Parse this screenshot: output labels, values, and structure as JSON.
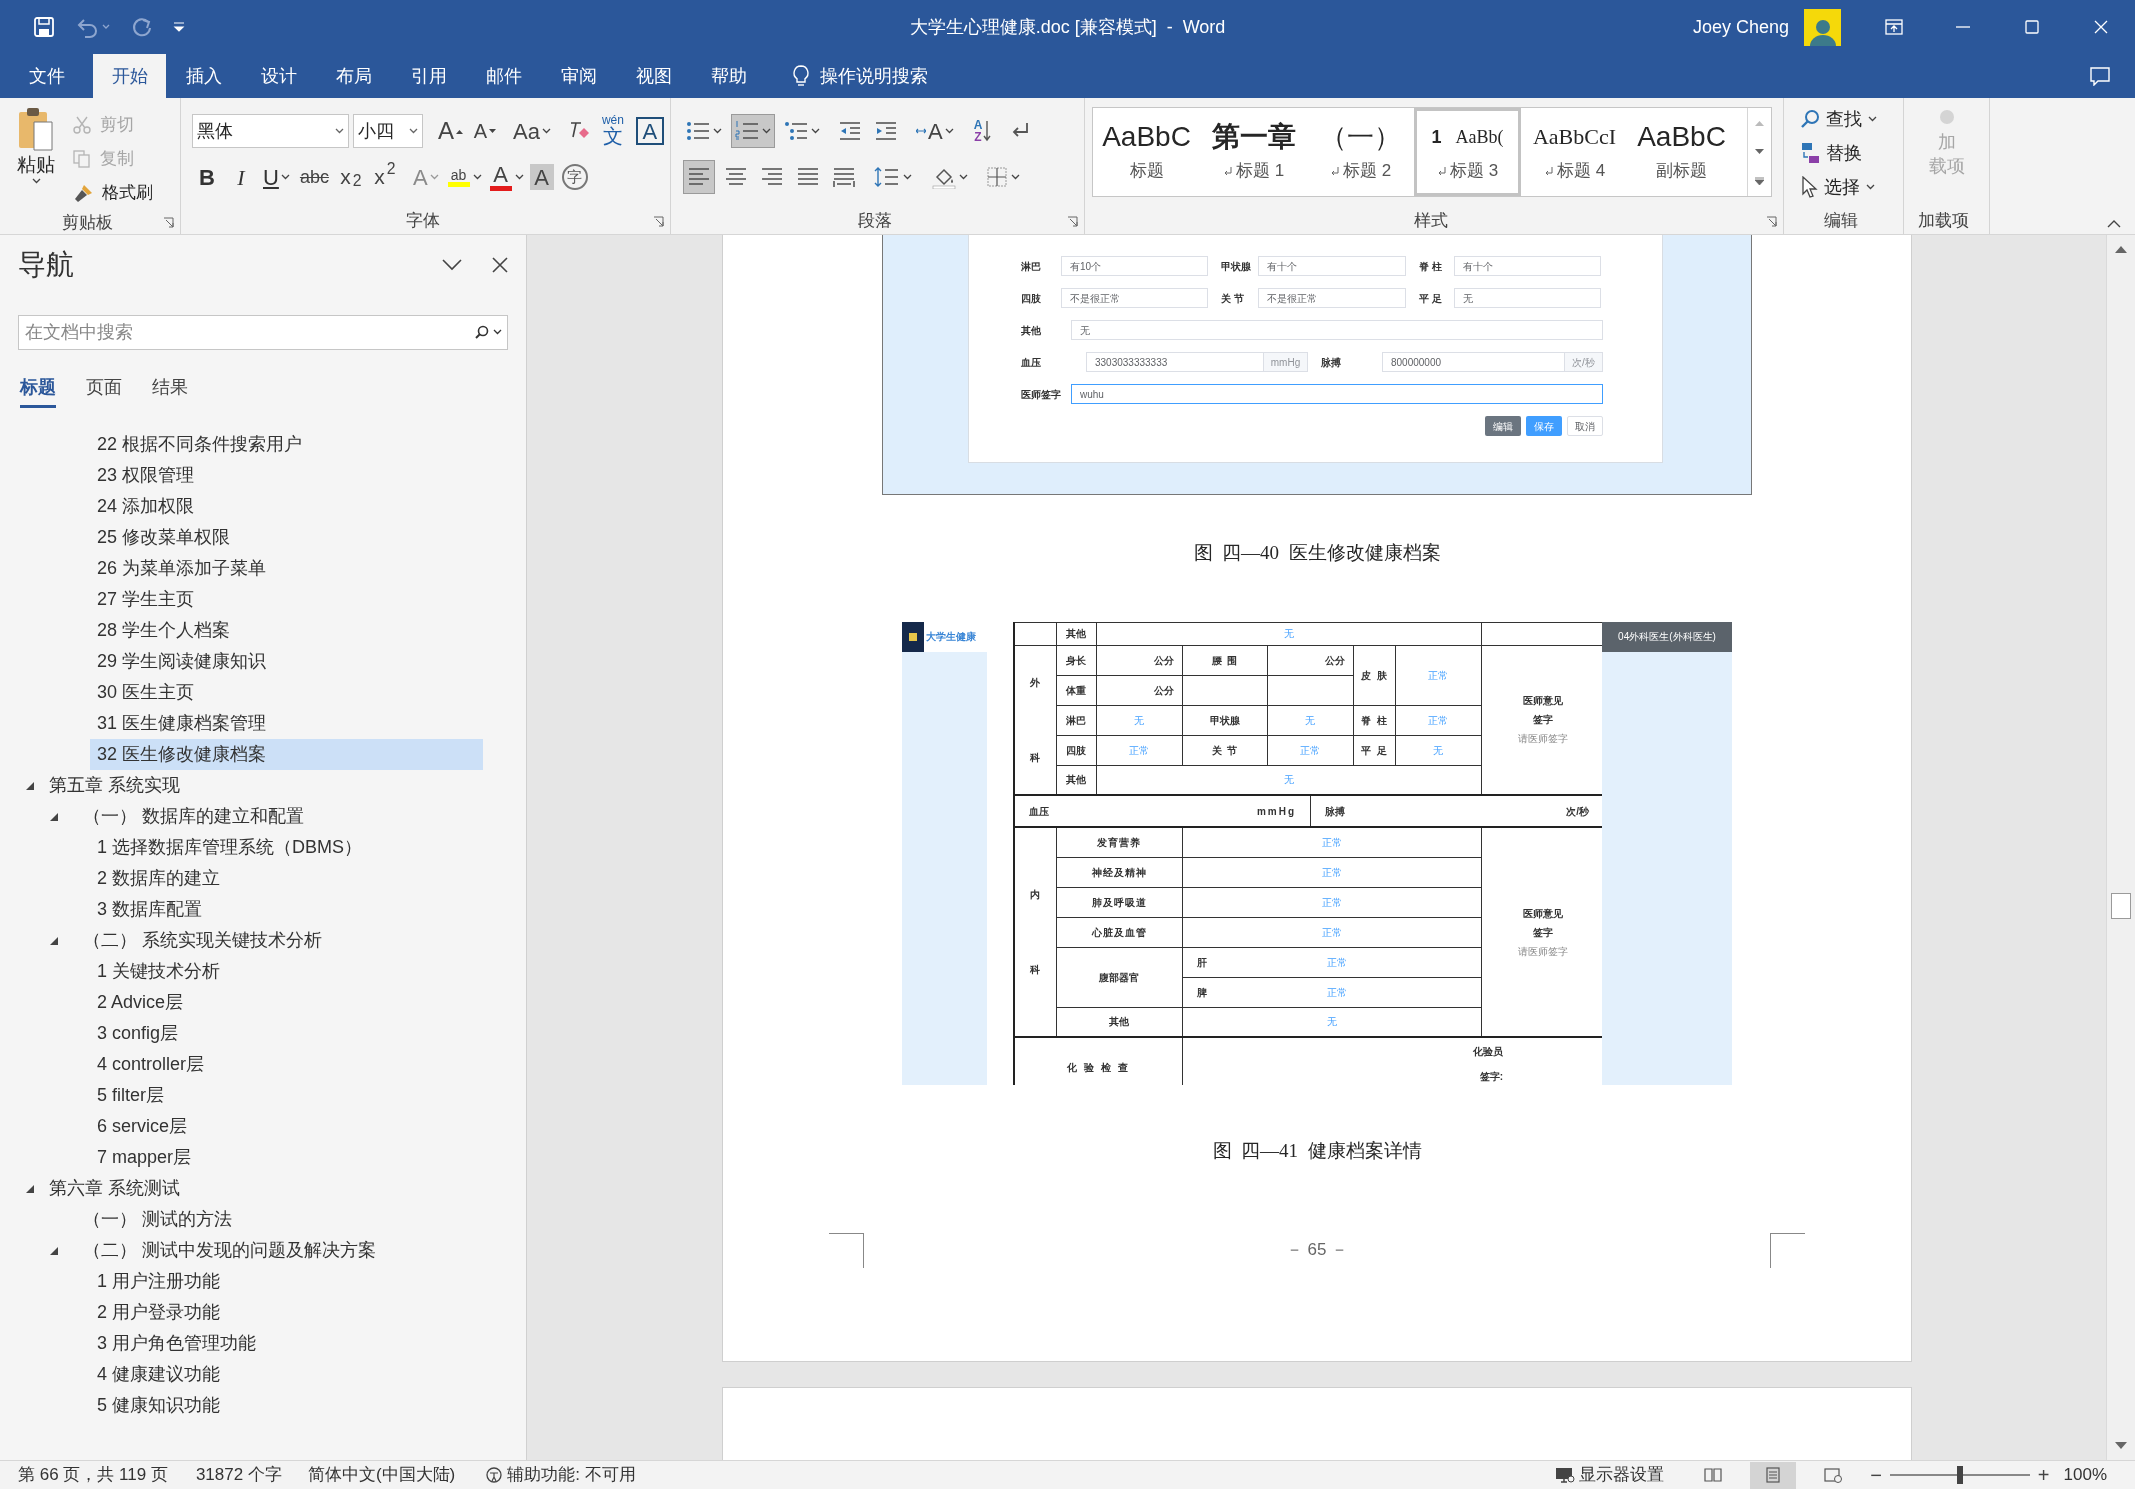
{
  "window": {
    "title": "大学生心理健康.doc [兼容模式]  -  Word",
    "user": "Joey Cheng"
  },
  "ribbon_tabs": [
    {
      "label": "文件",
      "selected": false
    },
    {
      "label": "开始",
      "selected": true
    },
    {
      "label": "插入",
      "selected": false
    },
    {
      "label": "设计",
      "selected": false
    },
    {
      "label": "布局",
      "selected": false
    },
    {
      "label": "引用",
      "selected": false
    },
    {
      "label": "邮件",
      "selected": false
    },
    {
      "label": "审阅",
      "selected": false
    },
    {
      "label": "视图",
      "selected": false
    },
    {
      "label": "帮助",
      "selected": false
    }
  ],
  "tell_me": "操作说明搜索",
  "ribbon": {
    "clipboard": {
      "paste": "粘贴",
      "cut": {
        "label": "剪切",
        "disabled": true
      },
      "copy": {
        "label": "复制",
        "disabled": true
      },
      "format_painter": {
        "label": "格式刷",
        "disabled": false
      },
      "group": "剪贴板"
    },
    "font": {
      "name": "黑体",
      "size": "小四",
      "grow": "A",
      "shrink": "A",
      "change_case": "Aa",
      "phonetic_top": "wén",
      "phonetic_char": "文",
      "char_border": "A",
      "bold": "B",
      "italic": "I",
      "underline": "U",
      "strike": "abc",
      "subscript": "x$_{2}$",
      "superscript": "x$^{2}$",
      "text_effects": "A",
      "highlight": "ab",
      "font_color": "A",
      "char_shading": "A",
      "enclose": "字",
      "group": "字体"
    },
    "paragraph": {
      "numbering_selected": true,
      "asian_layout": "A",
      "sort_top": "A",
      "sort_bottom": "Z",
      "align": [
        {
          "kind": "left",
          "selected": true
        },
        {
          "kind": "center",
          "selected": false
        },
        {
          "kind": "right",
          "selected": false
        },
        {
          "kind": "justify",
          "selected": false
        },
        {
          "kind": "distributed",
          "selected": false
        }
      ],
      "group": "段落"
    },
    "styles": {
      "items": [
        {
          "kind": "title",
          "preview": "AaBbC",
          "name": "标题",
          "para_mark": false,
          "selected": false
        },
        {
          "kind": "h1",
          "preview": "第一章",
          "name": "标题 1",
          "para_mark": true,
          "selected": false
        },
        {
          "kind": "h2",
          "preview": "（一）",
          "name": "标题 2",
          "para_mark": true,
          "selected": false
        },
        {
          "kind": "h3",
          "preview": "1",
          "preview_2": "AaBb(",
          "name": "标题 3",
          "para_mark": true,
          "selected": true
        },
        {
          "kind": "h4",
          "preview": "AaBbCcI",
          "name": "标题 4",
          "para_mark": true,
          "selected": false
        },
        {
          "kind": "subtitle",
          "preview": "AaBbC",
          "name": "副标题",
          "para_mark": false,
          "selected": false
        }
      ],
      "group": "样式"
    },
    "editing": {
      "find": "查找",
      "replace": "替换",
      "select": "选择",
      "group": "编辑"
    },
    "addins": {
      "button_lines": [
        "加",
        "载项"
      ],
      "disabled": true,
      "group": "加载项"
    }
  },
  "navigation": {
    "title": "导航",
    "search_placeholder": "在文档中搜索",
    "tabs": [
      {
        "label": "标题",
        "selected": true
      },
      {
        "label": "页面",
        "selected": false
      },
      {
        "label": "结果",
        "selected": false
      }
    ],
    "continued_items": [
      {
        "label": "22 根据不同条件搜索用户",
        "selected": false
      },
      {
        "label": "23 权限管理",
        "selected": false
      },
      {
        "label": "24 添加权限",
        "selected": false
      },
      {
        "label": "25 修改菜单权限",
        "selected": false
      },
      {
        "label": "26 为菜单添加子菜单",
        "selected": false
      },
      {
        "label": "27 学生主页",
        "selected": false
      },
      {
        "label": "28 学生个人档案",
        "selected": false
      },
      {
        "label": "29 学生阅读健康知识",
        "selected": false
      },
      {
        "label": "30 医生主页",
        "selected": false
      },
      {
        "label": "31 医生健康档案管理",
        "selected": false
      },
      {
        "label": "32 医生修改健康档案",
        "selected": true
      }
    ],
    "items": [
      {
        "label": "第五章 系统实现",
        "selected": false,
        "expanded": true,
        "children": [
          {
            "label": "（一） 数据库的建立和配置",
            "selected": false,
            "expanded": true,
            "children": [
              {
                "label": "1 选择数据库管理系统（DBMS）",
                "selected": false
              },
              {
                "label": "2 数据库的建立",
                "selected": false
              },
              {
                "label": "3 数据库配置",
                "selected": false
              }
            ]
          },
          {
            "label": "（二） 系统实现关键技术分析",
            "selected": false,
            "expanded": true,
            "children": [
              {
                "label": "1 关键技术分析",
                "selected": false
              },
              {
                "label": "2 Advice层",
                "selected": false
              },
              {
                "label": "3 config层",
                "selected": false
              },
              {
                "label": "4 controller层",
                "selected": false
              },
              {
                "label": "5 filter层",
                "selected": false
              },
              {
                "label": "6 service层",
                "selected": false
              },
              {
                "label": "7 mapper层",
                "selected": false
              }
            ]
          }
        ]
      },
      {
        "label": "第六章 系统测试",
        "selected": false,
        "expanded": true,
        "children": [
          {
            "label": "（一） 测试的方法",
            "selected": false
          },
          {
            "label": "（二） 测试中发现的问题及解决方案",
            "selected": false,
            "expanded": true,
            "children": [
              {
                "label": "1 用户注册功能",
                "selected": false
              },
              {
                "label": "2 用户登录功能",
                "selected": false
              },
              {
                "label": "3 用户角色管理功能",
                "selected": false
              },
              {
                "label": "4 健康建议功能",
                "selected": false
              },
              {
                "label": "5 健康知识功能",
                "selected": false
              }
            ]
          }
        ]
      }
    ]
  },
  "document": {
    "figure_1": {
      "triple_rows": [
        [
          {
            "label": "淋巴",
            "value": "有10个"
          },
          {
            "label": "甲状腺",
            "value": "有十个"
          },
          {
            "label": "脊 柱",
            "value": "有十个"
          }
        ],
        [
          {
            "label": "四肢",
            "value": "不是很正常"
          },
          {
            "label": "关 节",
            "value": "不是很正常"
          },
          {
            "label": "平 足",
            "value": "无"
          }
        ]
      ],
      "other": {
        "label": "其他",
        "value": "无"
      },
      "blood_pressure": {
        "label": "血压",
        "value": "3303033333333",
        "unit": "mmHg"
      },
      "pulse": {
        "label": "脉搏",
        "value": "800000000",
        "unit": "次/秒"
      },
      "signature": {
        "label": "医师签字",
        "value": "wuhu",
        "focused": true
      },
      "buttons": [
        {
          "label": "编辑",
          "kind": "dark"
        },
        {
          "label": "保存",
          "kind": "primary"
        },
        {
          "label": "取消",
          "kind": "plain"
        }
      ]
    },
    "caption_1": "图  四—40  医生修改健康档案",
    "figure_2": {
      "app_title": "大学生健康",
      "user_menu": "04外科医生(外科医生)",
      "top_row": {
        "label": "其他",
        "value": "无"
      },
      "surgery": {
        "side_top": "外",
        "side_bottom": "科",
        "height": {
          "label": "身长",
          "unit": "公分"
        },
        "waist": {
          "label": "腰  围",
          "unit": "公分"
        },
        "weight": {
          "label": "体重",
          "unit": "公分"
        },
        "skin": {
          "label": "皮  肤",
          "value": "正常"
        },
        "pairs": [
          [
            {
              "label": "淋巴",
              "value": "无"
            },
            {
              "label": "甲状腺",
              "value": "无"
            },
            {
              "label": "脊  柱",
              "value": "正常"
            }
          ],
          [
            {
              "label": "四肢",
              "value": "正常"
            },
            {
              "label": "关  节",
              "value": "正常"
            },
            {
              "label": "平  足",
              "value": "无"
            }
          ]
        ],
        "other": {
          "label": "其他",
          "value": "无"
        },
        "opinion": [
          "医师意见",
          "签字"
        ],
        "opinion_hint": "请医师签字"
      },
      "vitals": {
        "bp_label": "血压",
        "bp_unit": "mmHg",
        "pulse_label": "脉搏",
        "pulse_unit": "次/秒"
      },
      "internal": {
        "side_top": "内",
        "side_bottom": "科",
        "rows": [
          {
            "label": "发育营养",
            "value": "正常"
          },
          {
            "label": "神经及精神",
            "value": "正常"
          },
          {
            "label": "肺及呼吸道",
            "value": "正常"
          },
          {
            "label": "心脏及血管",
            "value": "正常"
          }
        ],
        "abdomen": {
          "label": "腹部器官",
          "parts": [
            {
              "label": "肝",
              "value": "正常"
            },
            {
              "label": "脾",
              "value": "正常"
            }
          ]
        },
        "other": {
          "label": "其他",
          "value": "无"
        },
        "opinion": [
          "医师意见",
          "签字"
        ],
        "opinion_hint": "请医师签字"
      },
      "lab": {
        "label": "化 验 检 查",
        "staff": "化验员",
        "sign": "签字:"
      }
    },
    "caption_2": "图  四—41  健康档案详情",
    "page_number": "－ 65 －"
  },
  "status_bar": {
    "page": "第 66 页，共 119 页",
    "words": "31872 个字",
    "language": "简体中文(中国大陆)",
    "accessibility": "辅助功能: 不可用",
    "display_settings": "显示器设置",
    "views": [
      {
        "kind": "read",
        "selected": false
      },
      {
        "kind": "print",
        "selected": true
      },
      {
        "kind": "web",
        "selected": false
      }
    ],
    "zoom_out": "−",
    "zoom_in": "+",
    "zoom": {
      "level": 0.5
    },
    "zoom_percent": "100%"
  }
}
